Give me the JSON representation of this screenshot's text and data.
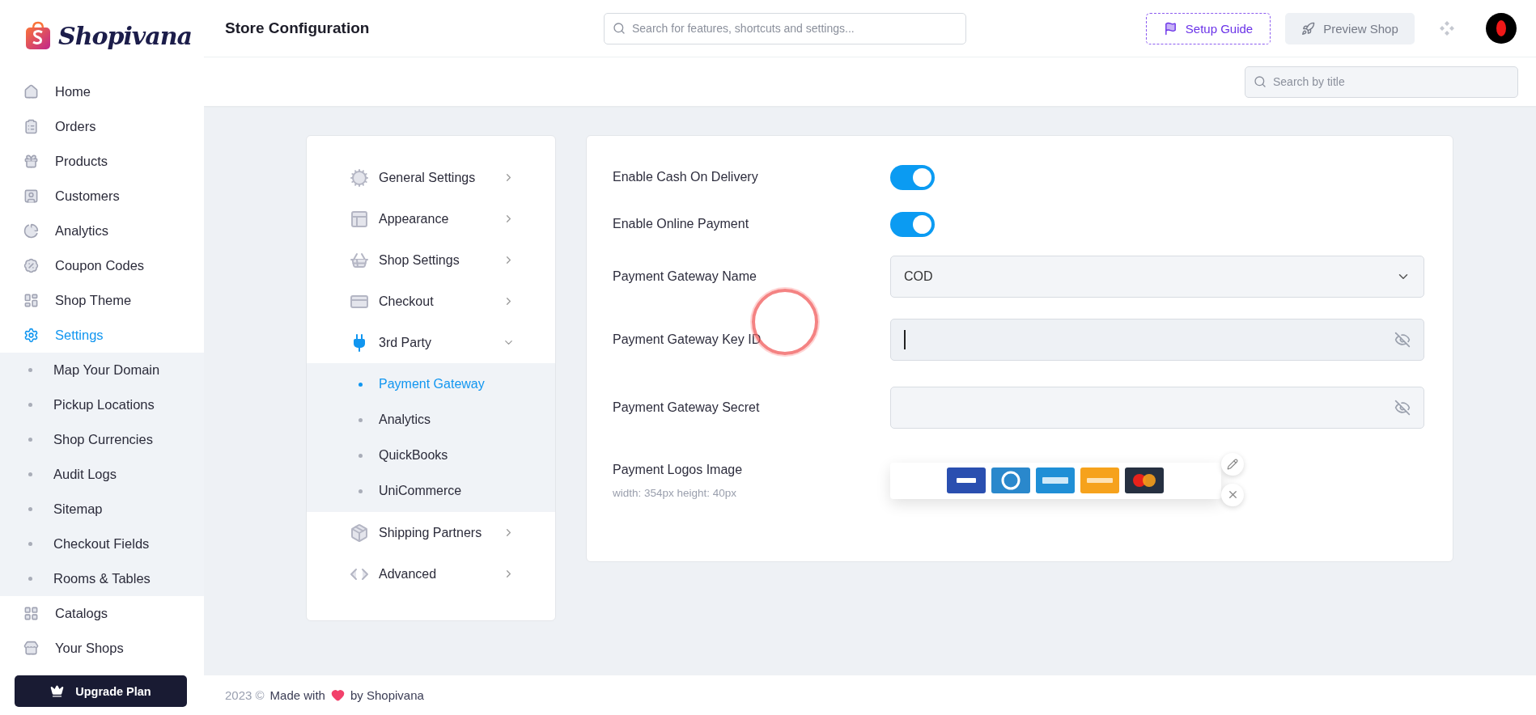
{
  "logo": {
    "text": "Shopivana"
  },
  "sidebar": {
    "items": [
      {
        "label": "Home",
        "selected": false
      },
      {
        "label": "Orders",
        "selected": false
      },
      {
        "label": "Products",
        "selected": false
      },
      {
        "label": "Customers",
        "selected": false
      },
      {
        "label": "Analytics",
        "selected": false
      },
      {
        "label": "Coupon Codes",
        "selected": false
      },
      {
        "label": "Shop Theme",
        "selected": false
      },
      {
        "label": "Settings",
        "selected": true,
        "expanded": true,
        "children": [
          {
            "label": "Map Your Domain",
            "selected": false
          },
          {
            "label": "Pickup Locations",
            "selected": false
          },
          {
            "label": "Shop Currencies",
            "selected": false
          },
          {
            "label": "Audit Logs",
            "selected": false
          },
          {
            "label": "Sitemap",
            "selected": false
          },
          {
            "label": "Checkout Fields",
            "selected": false
          },
          {
            "label": "Rooms & Tables",
            "selected": false
          }
        ]
      },
      {
        "label": "Catalogs",
        "selected": false
      },
      {
        "label": "Your Shops",
        "selected": false
      }
    ],
    "upgrade_button": "Upgrade Plan"
  },
  "header": {
    "title": "Store Configuration",
    "search_placeholder": "Search for features, shortcuts and settings...",
    "setup_guide": "Setup Guide",
    "preview_shop": "Preview Shop"
  },
  "toolbar": {
    "search_placeholder": "Search by title"
  },
  "settings_nav": {
    "items": [
      {
        "label": "General Settings",
        "selected": false,
        "expanded": false
      },
      {
        "label": "Appearance",
        "selected": false,
        "expanded": false
      },
      {
        "label": "Shop Settings",
        "selected": false,
        "expanded": false
      },
      {
        "label": "Checkout",
        "selected": false,
        "expanded": false
      },
      {
        "label": "3rd Party",
        "selected": true,
        "expanded": true,
        "children": [
          {
            "label": "Payment Gateway",
            "selected": true
          },
          {
            "label": "Analytics",
            "selected": false
          },
          {
            "label": "QuickBooks",
            "selected": false
          },
          {
            "label": "UniCommerce",
            "selected": false
          }
        ]
      },
      {
        "label": "Shipping Partners",
        "selected": false,
        "expanded": false
      },
      {
        "label": "Advanced",
        "selected": false,
        "expanded": false
      }
    ]
  },
  "form": {
    "fields": [
      {
        "kind": "toggle",
        "label": "Enable Cash On Delivery",
        "on": true
      },
      {
        "kind": "toggle",
        "label": "Enable Online Payment",
        "on": true
      },
      {
        "kind": "select",
        "label": "Payment Gateway Name",
        "value": "COD"
      },
      {
        "kind": "secret",
        "label": "Payment Gateway Key ID",
        "focused": true,
        "clicked": true
      },
      {
        "kind": "secret",
        "label": "Payment Gateway Secret",
        "focused": false,
        "clicked": false
      },
      {
        "label": "Payment Logos Image",
        "hint": "width: 354px height: 40px"
      }
    ]
  },
  "footer": {
    "year": "2023 ©",
    "made_with": "Made with",
    "by": "by Shopivana"
  }
}
